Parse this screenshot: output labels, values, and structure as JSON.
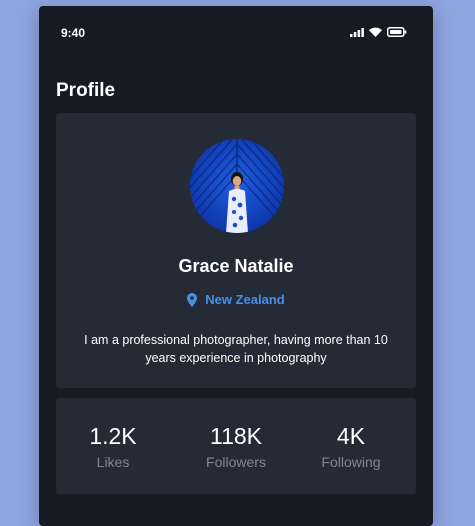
{
  "status_bar": {
    "time": "9:40"
  },
  "header": {
    "title": "Profile"
  },
  "profile": {
    "name": "Grace Natalie",
    "location": "New Zealand",
    "bio": "I am a professional photographer, having more than 10 years experience in photography"
  },
  "stats": [
    {
      "value": "1.2K",
      "label": "Likes"
    },
    {
      "value": "118K",
      "label": "Followers"
    },
    {
      "value": "4K",
      "label": "Following"
    }
  ],
  "colors": {
    "background": "#8fa5df",
    "screen": "#171b24",
    "card": "#242a36",
    "accent": "#4a8fe7",
    "muted_text": "#808795"
  },
  "icons": [
    "signal-icon",
    "wifi-icon",
    "battery-icon",
    "location-pin-icon"
  ]
}
